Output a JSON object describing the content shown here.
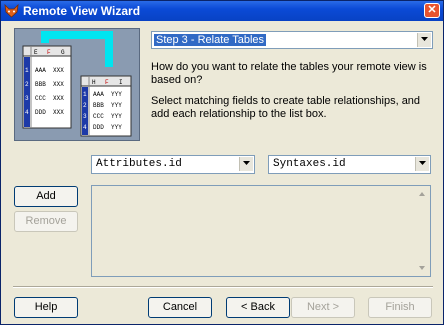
{
  "window": {
    "title": "Remote View Wizard"
  },
  "step_select": {
    "value": "Step 3 - Relate Tables"
  },
  "question": "How do you want to relate the tables your remote view is based on?",
  "instruction": "Select matching fields to create table relationships, and add each relationship to the list box.",
  "left_field": {
    "value": "Attributes.id"
  },
  "right_field": {
    "value": "Syntaxes.id"
  },
  "buttons": {
    "add": "Add",
    "remove": "Remove",
    "help": "Help",
    "cancel": "Cancel",
    "back": "< Back",
    "next": "Next >",
    "finish": "Finish"
  },
  "illustration": {
    "left_table": {
      "headers": [
        "E",
        "F",
        "G"
      ],
      "rows": [
        [
          "1",
          "AAA",
          "XXX"
        ],
        [
          "2",
          "BBB",
          "XXX"
        ],
        [
          "3",
          "CCC",
          "XXX"
        ],
        [
          "4",
          "DDD",
          "XXX"
        ]
      ]
    },
    "right_table": {
      "headers": [
        "H",
        "F",
        "I"
      ],
      "rows": [
        [
          "1",
          "AAA",
          "YYY"
        ],
        [
          "2",
          "BBB",
          "YYY"
        ],
        [
          "3",
          "CCC",
          "YYY"
        ],
        [
          "4",
          "DDD",
          "YYY"
        ]
      ]
    },
    "link_color": "#00e5f0"
  },
  "colors": {
    "titlebar": "#0b4ad6",
    "selection": "#316ac5",
    "link": "#00e5f0"
  }
}
